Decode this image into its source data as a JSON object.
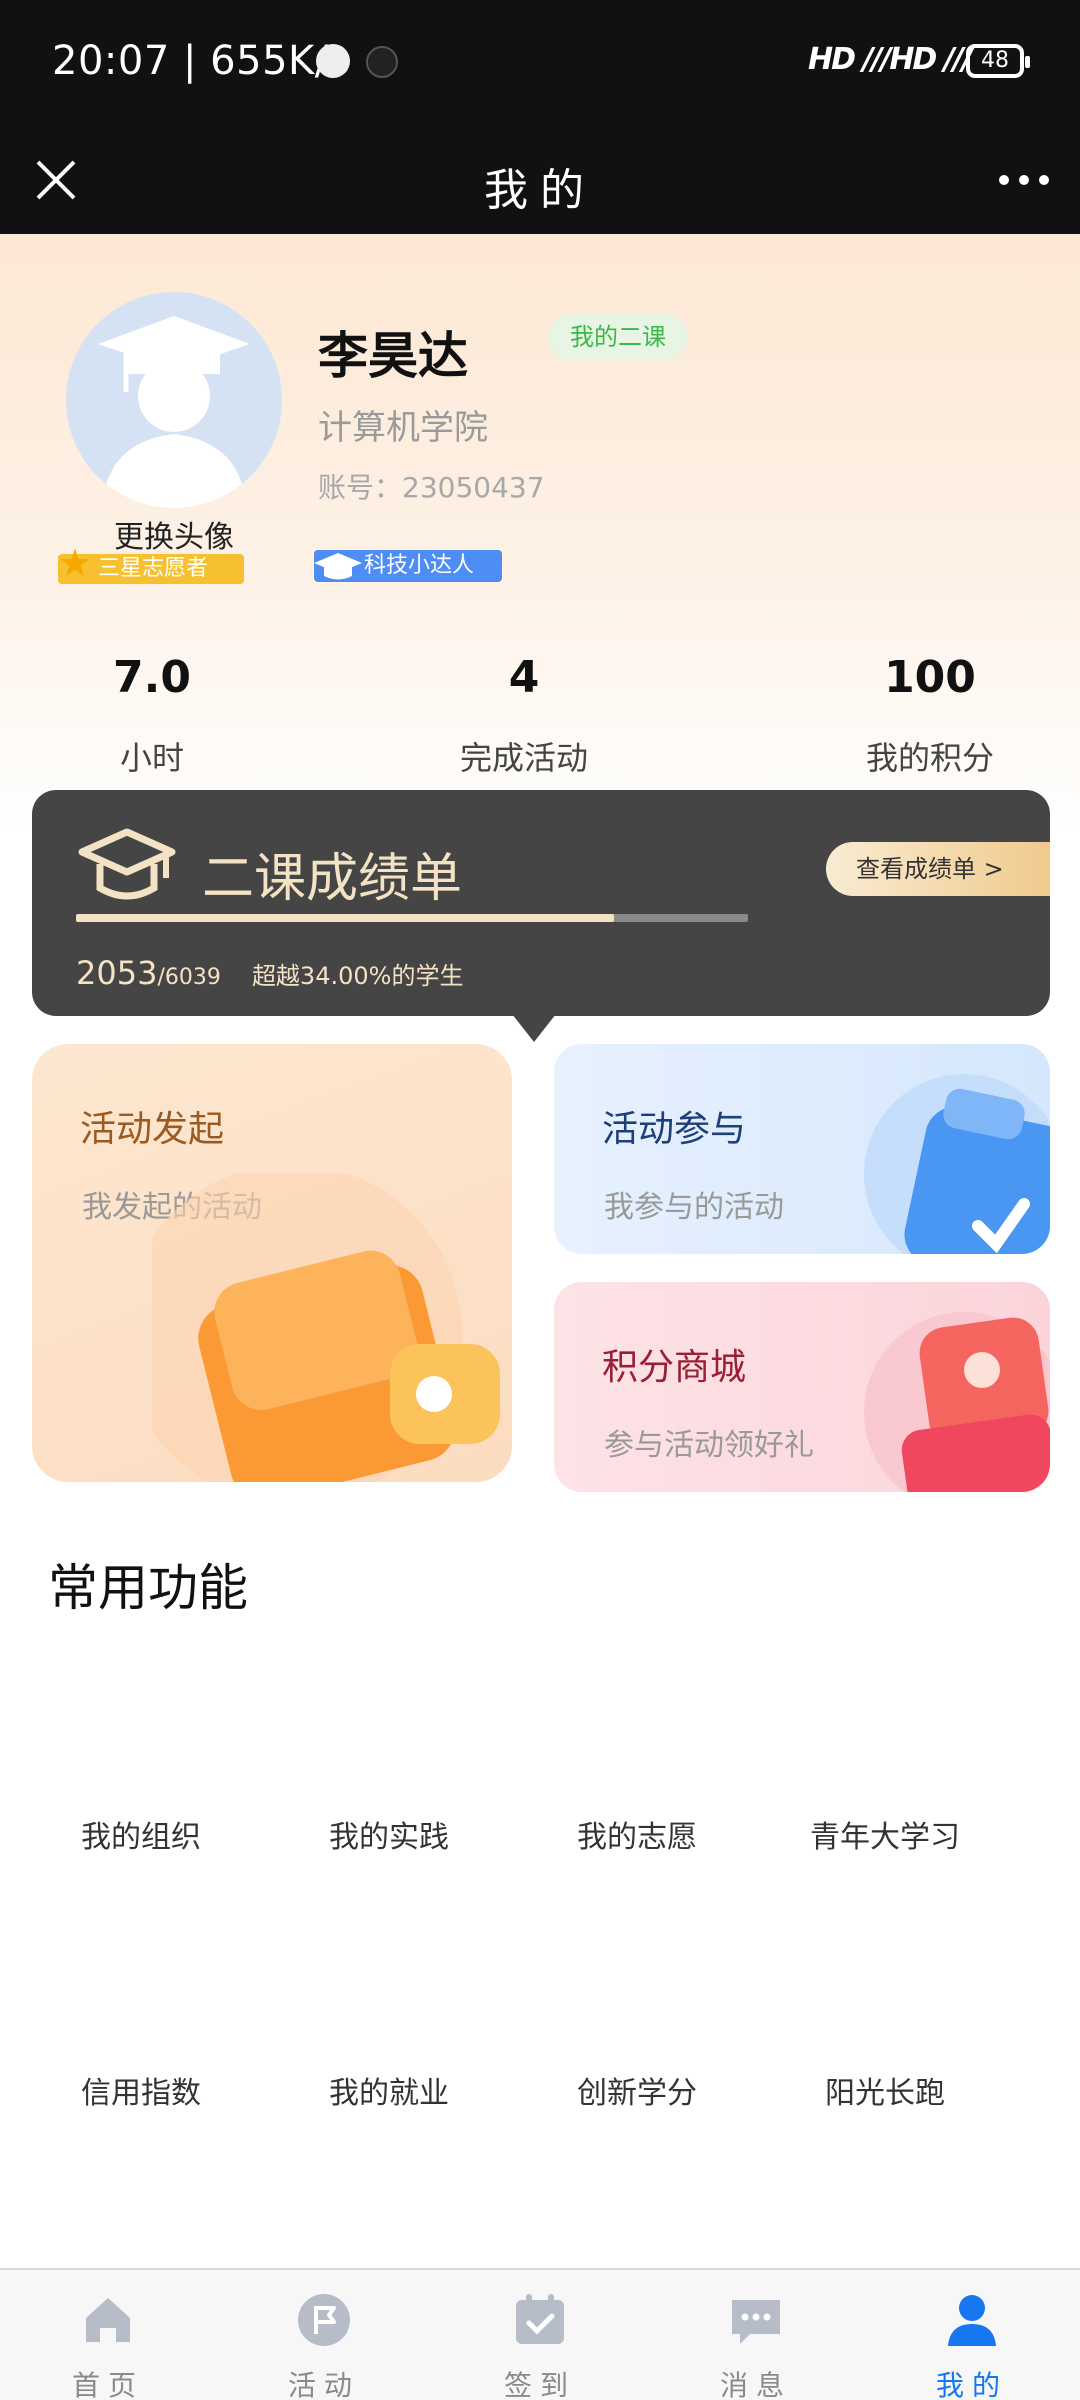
{
  "status_bar": {
    "time": "20:07 | 655K/s",
    "signal": "HD ///HD ///",
    "battery": "48"
  },
  "nav": {
    "title": "我的"
  },
  "profile": {
    "change_avatar": "更换头像",
    "star_badge": "三星志愿者",
    "name": "李昊达",
    "course_tag": "我的二课",
    "college": "计算机学院",
    "account": "账号：23050437",
    "tech_badge": "科技小达人"
  },
  "stats": [
    {
      "value": "7.0",
      "label": "小时"
    },
    {
      "value": "4",
      "label": "完成活动"
    },
    {
      "value": "100",
      "label": "我的积分"
    }
  ],
  "transcript": {
    "title": "二课成绩单",
    "view_button": "查看成绩单 >",
    "score": "2053",
    "total": "/6039",
    "rank_text": "超越34.00%的学生",
    "progress_fraction": 0.8
  },
  "cards": {
    "launch": {
      "title": "活动发起",
      "subtitle": "我发起的活动"
    },
    "join": {
      "title": "活动参与",
      "subtitle": "我参与的活动"
    },
    "mall": {
      "title": "积分商城",
      "subtitle": "参与活动领好礼"
    }
  },
  "functions": {
    "title": "常用功能",
    "items": [
      "我的组织",
      "我的实践",
      "我的志愿",
      "青年大学习",
      "信用指数",
      "我的就业",
      "创新学分",
      "阳光长跑"
    ]
  },
  "tabbar": {
    "items": [
      "首页",
      "活动",
      "签到",
      "消息",
      "我的"
    ],
    "active_color": "#1677f0"
  }
}
